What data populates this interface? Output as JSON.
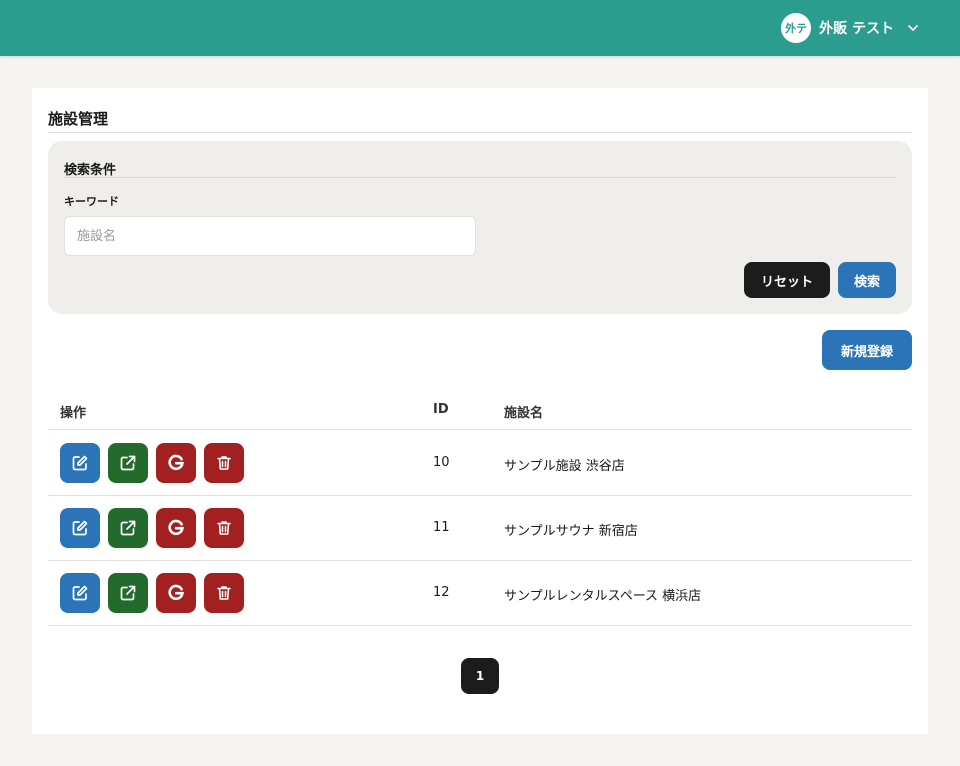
{
  "header": {
    "avatar_text": "外テ",
    "user_name": "外販 テスト",
    "bar_color": "#2a9d8f"
  },
  "page": {
    "title": "施設管理"
  },
  "search": {
    "title": "検索条件",
    "keyword_label": "キーワード",
    "keyword_value": "",
    "keyword_placeholder": "施設名",
    "reset_label": "リセット",
    "search_label": "検索"
  },
  "actions": {
    "new_label": "新規登録"
  },
  "table": {
    "columns": [
      "操作",
      "ID",
      "施設名"
    ],
    "row_actions": [
      "edit-icon",
      "external-link-icon",
      "google-icon",
      "trash-icon"
    ],
    "rows": [
      {
        "id": "10",
        "name": "サンプル施設 渋谷店"
      },
      {
        "id": "11",
        "name": "サンプルサウナ 新宿店"
      },
      {
        "id": "12",
        "name": "サンプルレンタルスペース 横浜店"
      }
    ]
  },
  "pagination": {
    "current_page": "1"
  },
  "colors": {
    "primary": "#2b74b8",
    "open": "#236b2d",
    "danger": "#a32020",
    "dark": "#1c1c1c"
  }
}
